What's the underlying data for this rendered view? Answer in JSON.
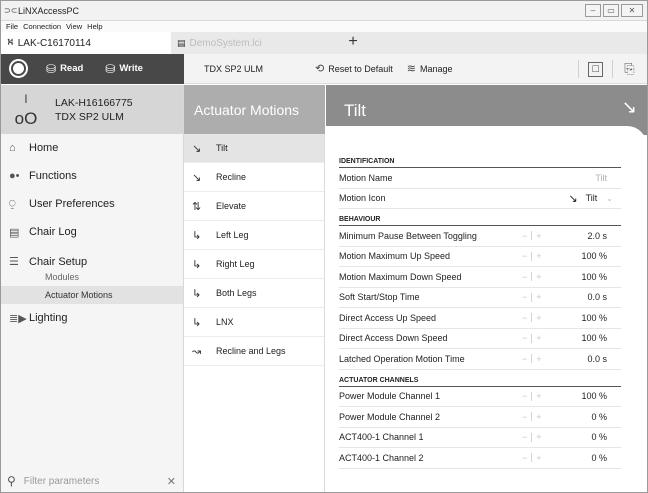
{
  "window": {
    "title": "LiNXAccessPC",
    "controls": {
      "minimize": "–",
      "maximize": "▭",
      "close": "✕"
    }
  },
  "menu": [
    "File",
    "Connection",
    "View",
    "Help"
  ],
  "tabs": [
    {
      "label": "LAK-C16170114",
      "active": true
    },
    {
      "label": "DemoSystem.lci",
      "active": false
    }
  ],
  "tab_add": "+",
  "toolbar": {
    "read_label": "Read",
    "write_label": "Write",
    "device_label": "TDX SP2 ULM",
    "reset_label": "Reset to Default",
    "manage_label": "Manage"
  },
  "device": {
    "id": "LAK-H16166775",
    "model": "TDX SP2 ULM"
  },
  "nav": {
    "home": "Home",
    "functions": "Functions",
    "user_preferences": "User Preferences",
    "chair_log": "Chair Log",
    "chair_setup": "Chair Setup",
    "modules": "Modules",
    "actuator_motions": "Actuator Motions",
    "lighting": "Lighting"
  },
  "filter": {
    "placeholder": "Filter parameters",
    "clear": "✕"
  },
  "middle": {
    "title": "Actuator Motions",
    "items": [
      "Tilt",
      "Recline",
      "Elevate",
      "Left Leg",
      "Right Leg",
      "Both Legs",
      "LNX",
      "Recline and Legs"
    ]
  },
  "main": {
    "title": "Tilt",
    "sections": {
      "identification": {
        "header": "IDENTIFICATION",
        "motion_name_label": "Motion Name",
        "motion_name_value": "Tilt",
        "motion_icon_label": "Motion Icon",
        "motion_icon_value": "Tilt"
      },
      "behaviour": {
        "header": "BEHAVIOUR",
        "rows": [
          {
            "label": "Minimum Pause Between Toggling",
            "value": "2.0 s"
          },
          {
            "label": "Motion Maximum Up Speed",
            "value": "100 %"
          },
          {
            "label": "Motion Maximum Down Speed",
            "value": "100 %"
          },
          {
            "label": "Soft Start/Stop Time",
            "value": "0.0 s"
          },
          {
            "label": "Direct Access Up Speed",
            "value": "100 %"
          },
          {
            "label": "Direct Access Down Speed",
            "value": "100 %"
          },
          {
            "label": "Latched Operation Motion Time",
            "value": "0.0 s"
          }
        ]
      },
      "channels": {
        "header": "ACTUATOR CHANNELS",
        "rows": [
          {
            "label": "Power Module Channel 1",
            "value": "100 %"
          },
          {
            "label": "Power Module Channel 2",
            "value": "0 %"
          },
          {
            "label": "ACT400-1 Channel 1",
            "value": "0 %"
          },
          {
            "label": "ACT400-1 Channel 2",
            "value": "0 %"
          }
        ]
      }
    }
  },
  "stepper": {
    "minus": "−",
    "plus": "+"
  },
  "colors": {
    "sidebar_dark": "#484848",
    "middle_header": "#adadad",
    "main_header": "#8c8c8c"
  }
}
